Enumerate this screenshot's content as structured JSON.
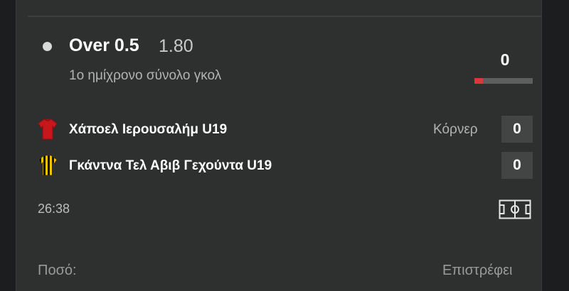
{
  "selection": {
    "name": "Over 0.5",
    "odds": "1.80",
    "market": "1ο ημίχρονο σύνολο γκολ",
    "live_count": "0",
    "progress": 0.15
  },
  "match": {
    "home_team": "Χάποελ Ιερουσαλήμ U19",
    "away_team": "Γκάντνα Τελ Αβιβ Γεχούντα U19",
    "corner_label": "Κόρνερ",
    "home_corners": "0",
    "away_corners": "0",
    "time": "26:38"
  },
  "bet": {
    "amount_label": "Ποσό:",
    "returns_label": "Επιστρέφει"
  },
  "colors": {
    "card_bg": "#2e302f",
    "accent_red": "#e0353a",
    "home_jersey": "#c8161d",
    "away_jersey_yellow": "#f2c300"
  },
  "icons": {
    "home": "red-jersey-icon",
    "away": "yellow-black-striped-jersey-icon",
    "pitch": "football-pitch-icon",
    "status": "bullet-dot-icon"
  }
}
